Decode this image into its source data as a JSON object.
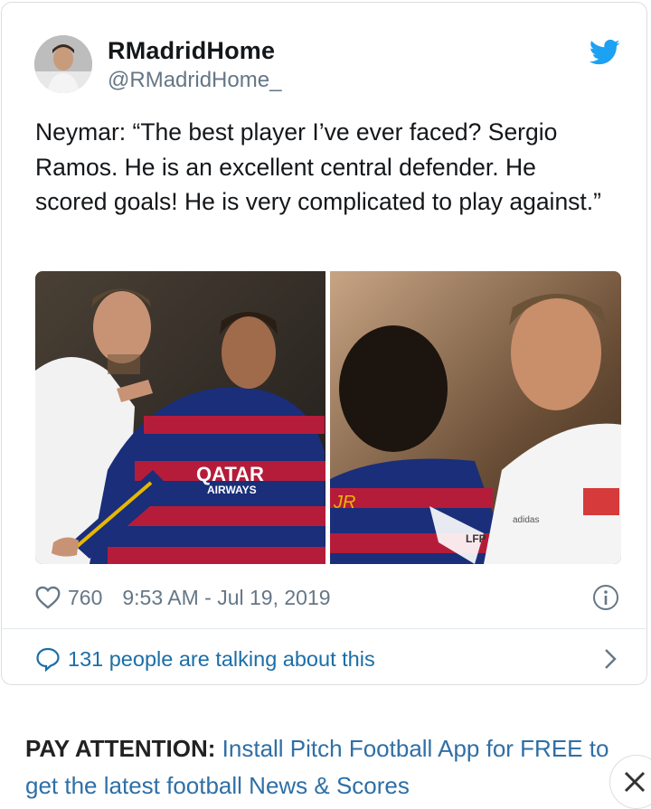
{
  "tweet": {
    "display_name": "RMadridHome",
    "handle": "@RMadridHome_",
    "text": "Neymar: “The best player I’ve ever faced? Sergio Ramos. He is an excellent central defender. He scored goals! He is very complicated to play against.”",
    "likes": "760",
    "timestamp": "9:53 AM - Jul 19, 2019",
    "talking": "131 people are talking about this",
    "media": [
      {
        "left_jersey_text": "QATAR",
        "left_jersey_sub": "AIRWAYS"
      },
      {
        "right_jersey_text": "JR",
        "right_badge": "LFP",
        "right_brand": "adidas"
      }
    ]
  },
  "promo": {
    "bold": "PAY ATTENTION:",
    "text": " Install Pitch Football App for FREE to get the latest football News & Scores"
  },
  "icons": {
    "brand": "twitter-bird-icon",
    "like": "heart-icon",
    "info": "info-icon",
    "reply": "speech-bubble-icon",
    "chevron": "chevron-right-icon",
    "close": "close-icon"
  },
  "colors": {
    "twitter_blue": "#1da1f2",
    "link": "#1b6ea7",
    "muted": "#657786"
  }
}
